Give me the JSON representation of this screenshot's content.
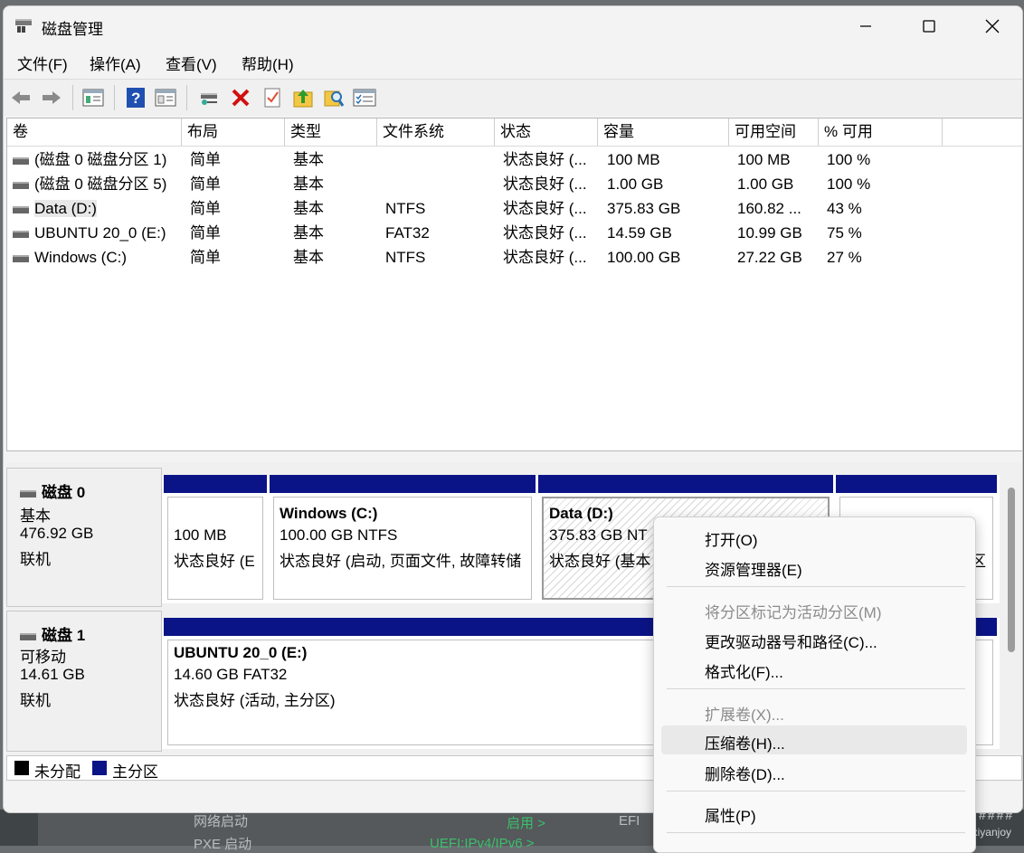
{
  "window": {
    "title": "磁盘管理"
  },
  "menu": [
    "文件(F)",
    "操作(A)",
    "查看(V)",
    "帮助(H)"
  ],
  "toolbar": [
    "back-icon",
    "forward-icon",
    "list-view-icon",
    "help-icon",
    "properties-view-icon",
    "connect-icon",
    "delete-icon",
    "check-icon",
    "up-folder-icon",
    "search-icon",
    "details-icon"
  ],
  "table": {
    "columns": [
      "卷",
      "布局",
      "类型",
      "文件系统",
      "状态",
      "容量",
      "可用空间",
      "% 可用"
    ],
    "rows": [
      {
        "vol": "(磁盘 0 磁盘分区 1)",
        "layout": "简单",
        "type": "基本",
        "fs": "",
        "status": "状态良好 (...",
        "cap": "100 MB",
        "free": "100 MB",
        "pct": "100 %"
      },
      {
        "vol": "(磁盘 0 磁盘分区 5)",
        "layout": "简单",
        "type": "基本",
        "fs": "",
        "status": "状态良好 (...",
        "cap": "1.00 GB",
        "free": "1.00 GB",
        "pct": "100 %"
      },
      {
        "vol": "Data (D:)",
        "layout": "简单",
        "type": "基本",
        "fs": "NTFS",
        "status": "状态良好 (...",
        "cap": "375.83 GB",
        "free": "160.82 ...",
        "pct": "43 %"
      },
      {
        "vol": "UBUNTU 20_0 (E:)",
        "layout": "简单",
        "type": "基本",
        "fs": "FAT32",
        "status": "状态良好 (...",
        "cap": "14.59 GB",
        "free": "10.99 GB",
        "pct": "75 %"
      },
      {
        "vol": "Windows (C:)",
        "layout": "简单",
        "type": "基本",
        "fs": "NTFS",
        "status": "状态良好 (...",
        "cap": "100.00 GB",
        "free": "27.22 GB",
        "pct": "27 %"
      }
    ]
  },
  "disks": [
    {
      "name": "磁盘 0",
      "kind": "基本",
      "size": "476.92 GB",
      "state": "联机",
      "parts": [
        {
          "l1": "",
          "l2": "100 MB",
          "l3": "状态良好 (E"
        },
        {
          "l1": "Windows  (C:)",
          "l2": "100.00 GB NTFS",
          "l3": "状态良好 (启动, 页面文件, 故障转储"
        },
        {
          "l1": "Data  (D:)",
          "l2": "375.83 GB NT",
          "l3": "状态良好 (基本"
        },
        {
          "l1": "",
          "l2": "",
          "l3": "区"
        }
      ]
    },
    {
      "name": "磁盘 1",
      "kind": "可移动",
      "size": "14.61 GB",
      "state": "联机",
      "parts": [
        {
          "l1": "UBUNTU 20_0  (E:)",
          "l2": "14.60 GB FAT32",
          "l3": "状态良好 (活动, 主分区)"
        }
      ]
    }
  ],
  "legend": {
    "unallocated": "未分配",
    "primary": "主分区",
    "unallocated_color": "#000000",
    "primary_color": "#0b1486"
  },
  "context_menu": {
    "items": [
      "打开(O)",
      "资源管理器(E)",
      "将分区标记为活动分区(M)",
      "更改驱动器号和路径(C)...",
      "格式化(F)...",
      "扩展卷(X)...",
      "压缩卷(H)...",
      "删除卷(D)...",
      "属性(P)"
    ],
    "disabled": [
      2,
      5
    ],
    "hover_index": 6
  },
  "background": {
    "t1": "网络启动",
    "t2": "PXE 启动",
    "t3": "启用 >",
    "t4": "UEFI:IPv4/IPv6 >",
    "t5": "EFI",
    "hashes": "####",
    "watermark": "CSDN @xiyanjoy"
  }
}
